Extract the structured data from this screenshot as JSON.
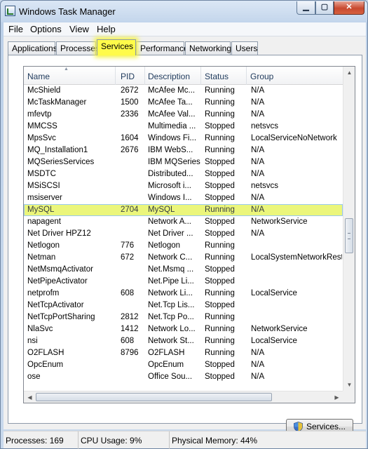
{
  "window": {
    "title": "Windows Task Manager",
    "controls": {
      "minimize": "▁",
      "maximize": "▢",
      "close": "✕"
    }
  },
  "menu": [
    "File",
    "Options",
    "View",
    "Help"
  ],
  "tabs": [
    {
      "label": "Applications",
      "active": false
    },
    {
      "label": "Processes",
      "active": false
    },
    {
      "label": "Services",
      "active": true
    },
    {
      "label": "Performance",
      "active": false
    },
    {
      "label": "Networking",
      "active": false
    },
    {
      "label": "Users",
      "active": false
    }
  ],
  "table": {
    "columns": [
      "Name",
      "PID",
      "Description",
      "Status",
      "Group"
    ],
    "rows": [
      {
        "name": "McShield",
        "pid": "2672",
        "description": "McAfee Mc...",
        "status": "Running",
        "group": "N/A"
      },
      {
        "name": "McTaskManager",
        "pid": "1500",
        "description": "McAfee Ta...",
        "status": "Running",
        "group": "N/A"
      },
      {
        "name": "mfevtp",
        "pid": "2336",
        "description": "McAfee Val...",
        "status": "Running",
        "group": "N/A"
      },
      {
        "name": "MMCSS",
        "pid": "",
        "description": "Multimedia ...",
        "status": "Stopped",
        "group": "netsvcs"
      },
      {
        "name": "MpsSvc",
        "pid": "1604",
        "description": "Windows Fi...",
        "status": "Running",
        "group": "LocalServiceNoNetwork"
      },
      {
        "name": "MQ_Installation1",
        "pid": "2676",
        "description": "IBM WebS...",
        "status": "Running",
        "group": "N/A"
      },
      {
        "name": "MQSeriesServices",
        "pid": "",
        "description": "IBM MQSeries",
        "status": "Stopped",
        "group": "N/A"
      },
      {
        "name": "MSDTC",
        "pid": "",
        "description": "Distributed...",
        "status": "Stopped",
        "group": "N/A"
      },
      {
        "name": "MSiSCSI",
        "pid": "",
        "description": "Microsoft i...",
        "status": "Stopped",
        "group": "netsvcs"
      },
      {
        "name": "msiserver",
        "pid": "",
        "description": "Windows I...",
        "status": "Stopped",
        "group": "N/A"
      },
      {
        "name": "MySQL",
        "pid": "2704",
        "description": "MySQL",
        "status": "Running",
        "group": "N/A",
        "highlighted": true
      },
      {
        "name": "napagent",
        "pid": "",
        "description": "Network A...",
        "status": "Stopped",
        "group": "NetworkService"
      },
      {
        "name": "Net Driver HPZ12",
        "pid": "",
        "description": "Net Driver ...",
        "status": "Stopped",
        "group": "N/A"
      },
      {
        "name": "Netlogon",
        "pid": "776",
        "description": "Netlogon",
        "status": "Running",
        "group": ""
      },
      {
        "name": "Netman",
        "pid": "672",
        "description": "Network C...",
        "status": "Running",
        "group": "LocalSystemNetworkRestric"
      },
      {
        "name": "NetMsmqActivator",
        "pid": "",
        "description": "Net.Msmq ...",
        "status": "Stopped",
        "group": ""
      },
      {
        "name": "NetPipeActivator",
        "pid": "",
        "description": "Net.Pipe Li...",
        "status": "Stopped",
        "group": ""
      },
      {
        "name": "netprofm",
        "pid": "608",
        "description": "Network Li...",
        "status": "Running",
        "group": "LocalService"
      },
      {
        "name": "NetTcpActivator",
        "pid": "",
        "description": "Net.Tcp Lis...",
        "status": "Stopped",
        "group": ""
      },
      {
        "name": "NetTcpPortSharing",
        "pid": "2812",
        "description": "Net.Tcp Po...",
        "status": "Running",
        "group": ""
      },
      {
        "name": "NlaSvc",
        "pid": "1412",
        "description": "Network Lo...",
        "status": "Running",
        "group": "NetworkService"
      },
      {
        "name": "nsi",
        "pid": "608",
        "description": "Network St...",
        "status": "Running",
        "group": "LocalService"
      },
      {
        "name": "O2FLASH",
        "pid": "8796",
        "description": "O2FLASH",
        "status": "Running",
        "group": "N/A"
      },
      {
        "name": "OpcEnum",
        "pid": "",
        "description": "OpcEnum",
        "status": "Stopped",
        "group": "N/A"
      },
      {
        "name": "ose",
        "pid": "",
        "description": "Office Sou...",
        "status": "Stopped",
        "group": "N/A"
      }
    ]
  },
  "services_button": "Services...",
  "status_bar": {
    "processes": "Processes: 169",
    "cpu": "CPU Usage: 9%",
    "memory": "Physical Memory: 44%"
  },
  "colors": {
    "highlight": "#f6fb4f",
    "active_tab": "#fffb4a",
    "window_frame": "#c9d9ec"
  }
}
